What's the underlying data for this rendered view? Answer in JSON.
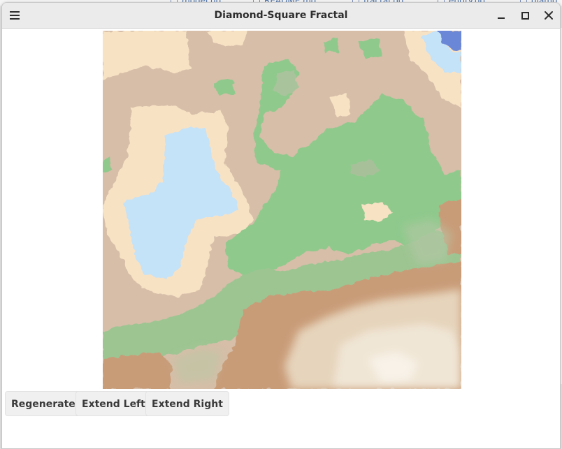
{
  "window": {
    "title": "Diamond-Square Fractal"
  },
  "background_tabs": [
    "model.go",
    "README.md",
    "fractal.go",
    "entity.go",
    "diamo"
  ],
  "canvas": {
    "description_colors": {
      "deep_water": "#6b86d6",
      "water": "#c6e2f8",
      "sand": "#fae2c2",
      "lowland": "#d8bfa8",
      "grass": "#8cc98a",
      "hill": "#c9a07c",
      "mountain": "#ece0cc"
    }
  },
  "buttons": {
    "regenerate": "Regenerate",
    "extend_left": "Extend Left",
    "extend_right": "Extend Right"
  }
}
